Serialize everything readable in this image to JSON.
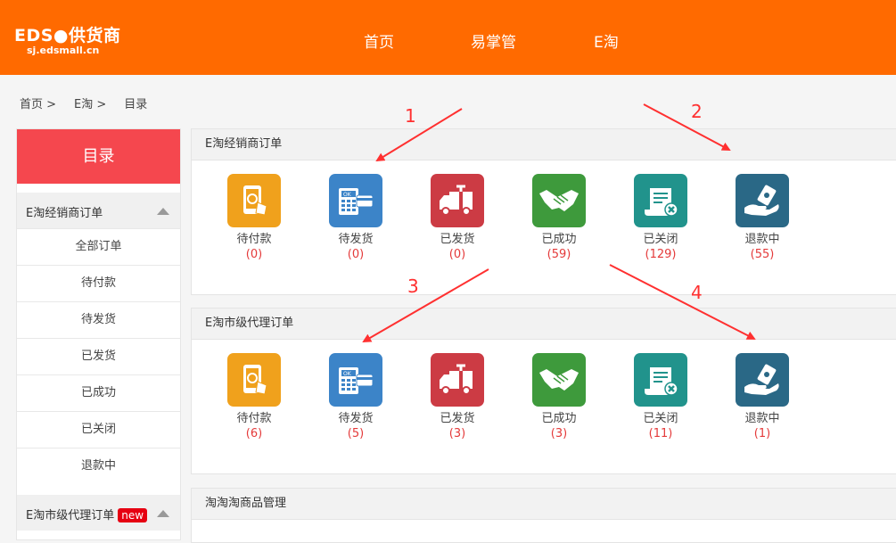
{
  "header": {
    "logo_title": "EDS●供货商",
    "logo_domain": "sj.edsmall.cn",
    "nav": [
      "首页",
      "易掌管",
      "E淘"
    ]
  },
  "breadcrumb": [
    "首页 >",
    "E淘 >",
    "目录"
  ],
  "sidebar": {
    "title": "目录",
    "group1": {
      "label": "E淘经销商订单",
      "items": [
        "全部订单",
        "待付款",
        "待发货",
        "已发货",
        "已成功",
        "已关闭",
        "退款中"
      ]
    },
    "group2": {
      "label": "E淘市级代理订单",
      "badge": "new"
    }
  },
  "panels": [
    {
      "title": "E淘经销商订单",
      "tiles": [
        {
          "label": "待付款",
          "count": "(0)",
          "icon": "tablet-pay-icon",
          "color": "#f0a11c"
        },
        {
          "label": "待发货",
          "count": "(0)",
          "icon": "pos-terminal-icon",
          "color": "#3c84c8"
        },
        {
          "label": "已发货",
          "count": "(0)",
          "icon": "delivery-truck-icon",
          "color": "#cc3b44"
        },
        {
          "label": "已成功",
          "count": "(59)",
          "icon": "handshake-icon",
          "color": "#3e9a3c"
        },
        {
          "label": "已关闭",
          "count": "(129)",
          "icon": "closed-scroll-icon",
          "color": "#21938c"
        },
        {
          "label": "退款中",
          "count": "(55)",
          "icon": "refund-hand-icon",
          "color": "#2a6886"
        }
      ]
    },
    {
      "title": "E淘市级代理订单",
      "tiles": [
        {
          "label": "待付款",
          "count": "(6)",
          "icon": "tablet-pay-icon",
          "color": "#f0a11c"
        },
        {
          "label": "待发货",
          "count": "(5)",
          "icon": "pos-terminal-icon",
          "color": "#3c84c8"
        },
        {
          "label": "已发货",
          "count": "(3)",
          "icon": "delivery-truck-icon",
          "color": "#cc3b44"
        },
        {
          "label": "已成功",
          "count": "(3)",
          "icon": "handshake-icon",
          "color": "#3e9a3c"
        },
        {
          "label": "已关闭",
          "count": "(11)",
          "icon": "closed-scroll-icon",
          "color": "#21938c"
        },
        {
          "label": "退款中",
          "count": "(1)",
          "icon": "refund-hand-icon",
          "color": "#2a6886"
        }
      ]
    },
    {
      "title": "淘淘淘商品管理",
      "tiles": []
    }
  ],
  "annotations": [
    "1",
    "2",
    "3",
    "4"
  ],
  "colors": {
    "header": "#ff6a00",
    "sidebar_title": "#f5474e",
    "count_text": "#e43a3a",
    "annotation": "#ff3030",
    "badge": "#e60012"
  }
}
